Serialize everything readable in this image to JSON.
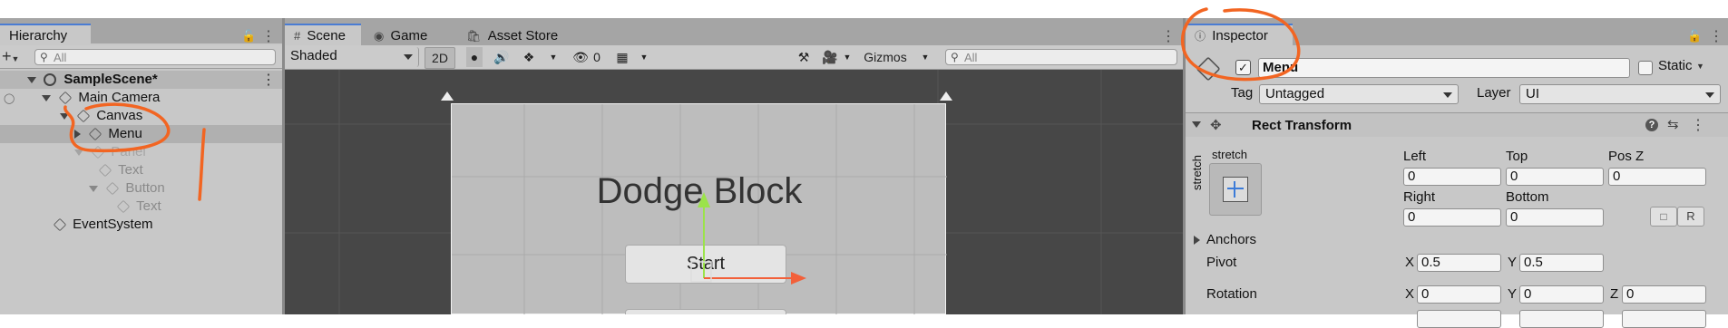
{
  "hierarchy": {
    "tab_label": "Hierarchy",
    "search_placeholder": "All",
    "add_label": "+",
    "scene_name": "SampleScene*",
    "items": [
      {
        "label": "Main Camera"
      },
      {
        "label": "Canvas"
      },
      {
        "label": "Menu"
      },
      {
        "label": "Panel"
      },
      {
        "label": "Text"
      },
      {
        "label": "Button"
      },
      {
        "label": "Text"
      },
      {
        "label": "EventSystem"
      }
    ]
  },
  "center_tabs": {
    "scene": "Scene",
    "game": "Game",
    "asset_store": "Asset Store"
  },
  "scene_toolbar": {
    "shading_mode": "Shaded",
    "mode_2d": "2D",
    "hidden_count": "0",
    "gizmos_label": "Gizmos",
    "search_placeholder": "All"
  },
  "scene_view": {
    "title_text": "Dodge Block",
    "start_button": "Start"
  },
  "inspector": {
    "tab_label": "Inspector",
    "object_name": "Menu",
    "active_checked": true,
    "static_label": "Static",
    "tag_label": "Tag",
    "tag_value": "Untagged",
    "layer_label": "Layer",
    "layer_value": "UI",
    "component_title": "Rect Transform",
    "anchor_preset_top": "stretch",
    "anchor_preset_side": "stretch",
    "left_label": "Left",
    "left_value": "0",
    "top_label": "Top",
    "top_value": "0",
    "posz_label": "Pos Z",
    "posz_value": "0",
    "right_label": "Right",
    "right_value": "0",
    "bottom_label": "Bottom",
    "bottom_value": "0",
    "raw_button": "R",
    "anchors_label": "Anchors",
    "pivot_label": "Pivot",
    "pivot_x_label": "X",
    "pivot_x": "0.5",
    "pivot_y_label": "Y",
    "pivot_y": "0.5",
    "rotation_label": "Rotation",
    "rot_x_label": "X",
    "rot_x": "0",
    "rot_y_label": "Y",
    "rot_y": "0",
    "rot_z_label": "Z",
    "rot_z": "0"
  },
  "colors": {
    "annotation": "#f26522",
    "tab_accent": "#4a7cd3",
    "scene_bg": "#474747",
    "selection": "#b0b0b0"
  }
}
